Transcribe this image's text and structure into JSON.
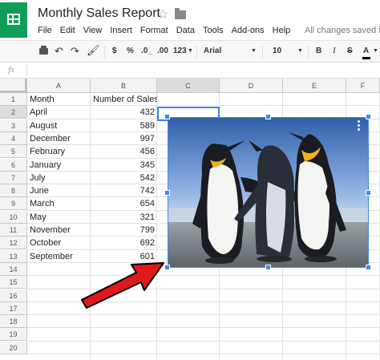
{
  "doc": {
    "title": "Monthly Sales Report",
    "save_status": "All changes saved in"
  },
  "menu": [
    "File",
    "Edit",
    "View",
    "Insert",
    "Format",
    "Data",
    "Tools",
    "Add-ons",
    "Help"
  ],
  "toolbar": {
    "currency": "$",
    "percent": "%",
    "dec_less": ".0_",
    "dec_more": ".00",
    "more_formats": "123",
    "font": "Arial",
    "font_size": "10",
    "bold": "B",
    "italic": "I",
    "strike": "S",
    "text_color": "A"
  },
  "formula": {
    "fx": "fx",
    "value": ""
  },
  "columns": [
    "A",
    "B",
    "C",
    "D",
    "E",
    "F"
  ],
  "rows": [
    "1",
    "2",
    "3",
    "4",
    "5",
    "6",
    "7",
    "8",
    "9",
    "10",
    "11",
    "12",
    "13",
    "14",
    "15",
    "16",
    "17",
    "18",
    "19",
    "20"
  ],
  "sheet": {
    "headers": [
      "Month",
      "Number of Sales"
    ],
    "data": [
      [
        "April",
        "432"
      ],
      [
        "August",
        "589"
      ],
      [
        "December",
        "997"
      ],
      [
        "February",
        "456"
      ],
      [
        "January",
        "345"
      ],
      [
        "July",
        "542"
      ],
      [
        "June",
        "742"
      ],
      [
        "March",
        "654"
      ],
      [
        "May",
        "321"
      ],
      [
        "November",
        "799"
      ],
      [
        "October",
        "692"
      ],
      [
        "September",
        "601"
      ]
    ]
  },
  "colors": {
    "accent": "#4285f4",
    "brand": "#0f9d58",
    "arrow": "#e0191c"
  },
  "icons": {
    "logo": "sheets-logo-icon",
    "star": "star-icon",
    "folder": "folder-icon",
    "image_menu": "kebab-menu-icon",
    "annotation": "red-arrow-icon"
  }
}
